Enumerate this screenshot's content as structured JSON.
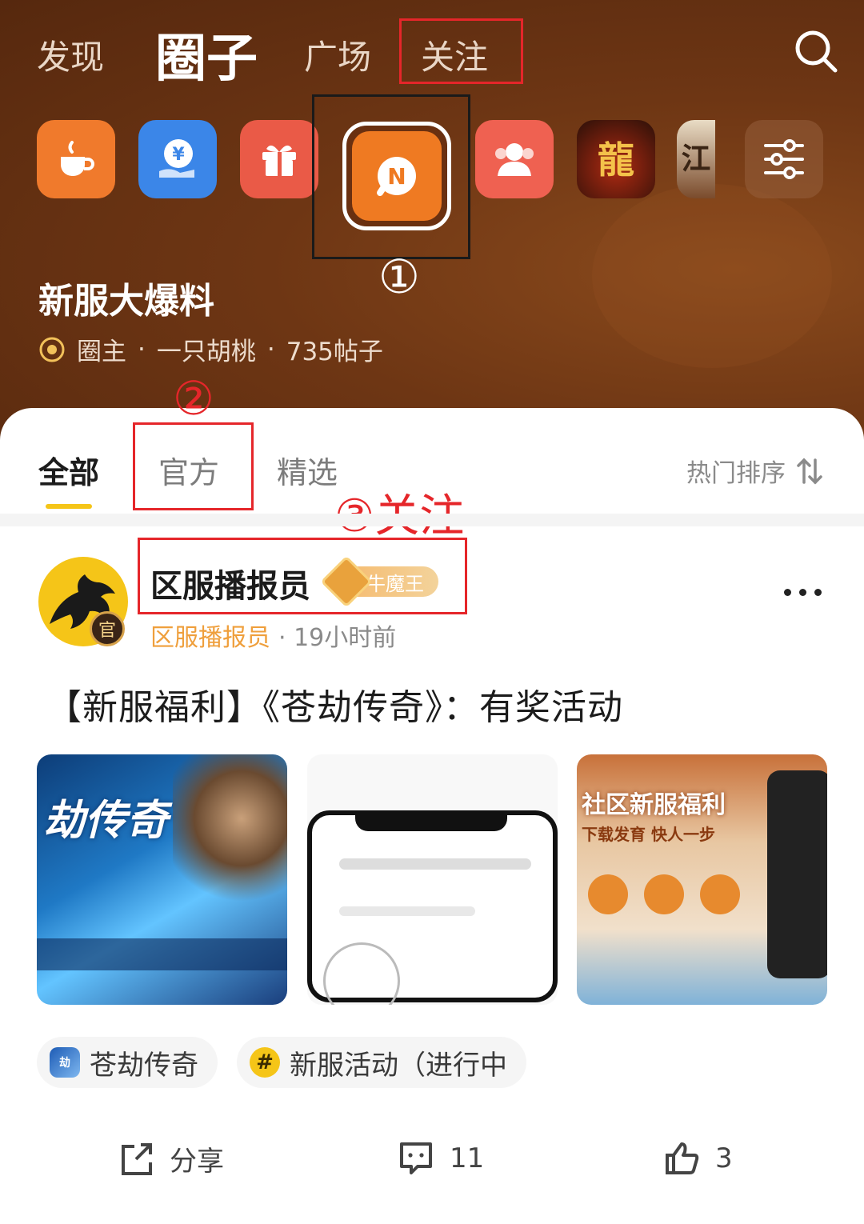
{
  "nav": {
    "tabs": [
      "发现",
      "圈子",
      "广场",
      "关注"
    ],
    "active_tab": "圈子"
  },
  "circles": [
    {
      "name": "coffee-circle-icon",
      "color": "#f07a2c"
    },
    {
      "name": "yuan-circle-icon",
      "color": "#3b86e8"
    },
    {
      "name": "gift-circle-icon",
      "color": "#ea5a47"
    },
    {
      "name": "n-circle-icon",
      "color": "#ef7a22"
    },
    {
      "name": "users-circle-icon",
      "color": "#ef6151"
    },
    {
      "name": "dragon-game-icon",
      "color": "#2a1a14"
    },
    {
      "name": "jianghu-game-icon",
      "color": "#8a5a3a"
    },
    {
      "name": "filter-settings-icon",
      "color": "#8a5436"
    }
  ],
  "annotations": {
    "circle_1": "①",
    "circle_2": "②",
    "step_3": "③关注"
  },
  "circle_info": {
    "title": "新服大爆料",
    "meta_owner_label": "圈主",
    "dot": "·",
    "owner_name": "一只胡桃",
    "post_count": "735帖子"
  },
  "subtabs": {
    "all": "全部",
    "official": "官方",
    "featured": "精选",
    "sort": "热门排序"
  },
  "post": {
    "avatar_badge": "官",
    "author": "区服播报员",
    "rank": "牛魔王",
    "sub_author": "区服播报员",
    "time": "· 19小时前",
    "title": "【新服福利】《苍劫传奇》：有奖活动",
    "thumb1_caption": "劫传奇",
    "thumb3_caption": "社区新服福利",
    "thumb3_sub": "下载发育 快人一步",
    "tags": [
      {
        "label": "苍劫传奇",
        "icon": "game-tag-icon"
      },
      {
        "label": "新服活动（进行中",
        "icon": "hashtag-icon"
      }
    ],
    "actions": {
      "share": "分享",
      "comments": "11",
      "likes": "3"
    }
  }
}
